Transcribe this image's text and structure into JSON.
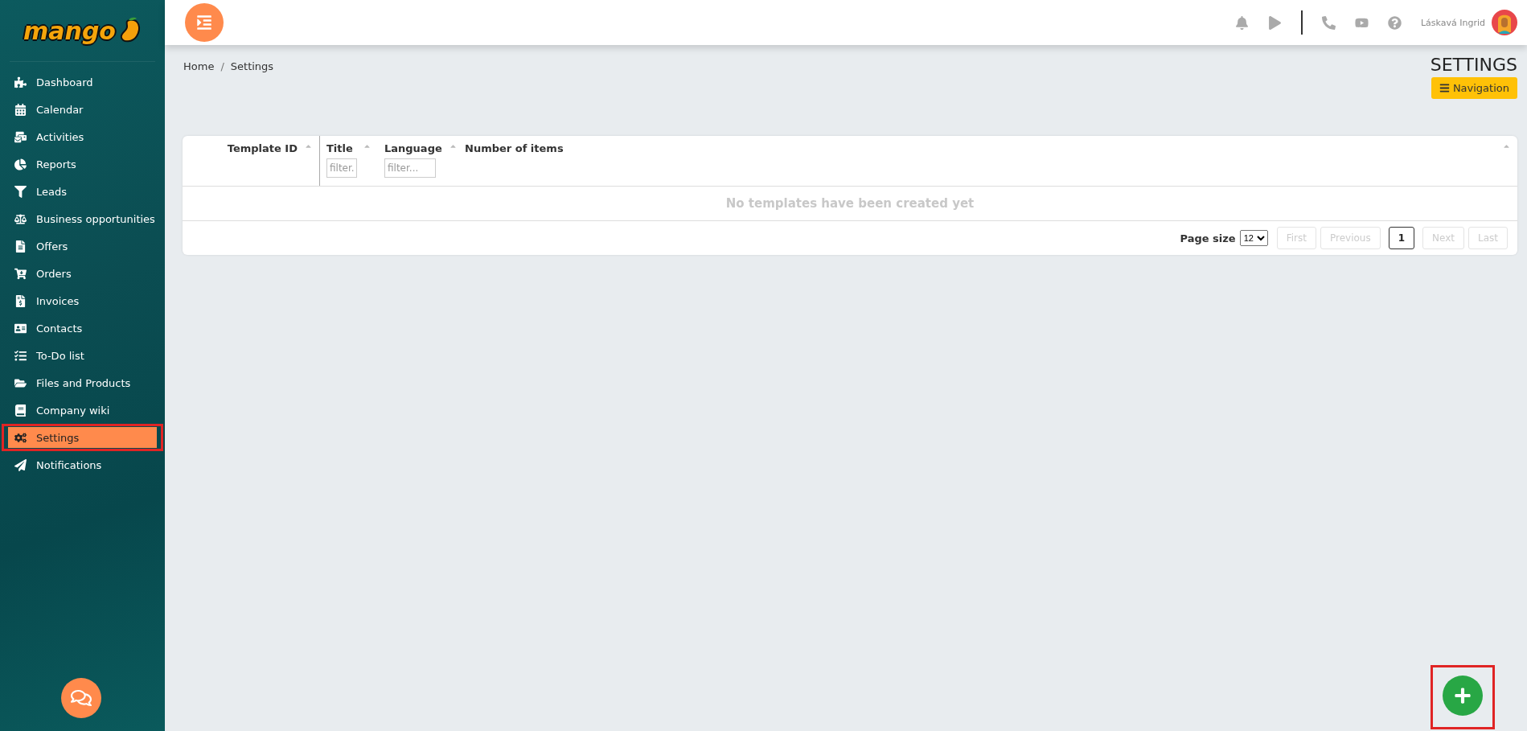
{
  "logo": {
    "text": "mango"
  },
  "sidebar": {
    "items": [
      {
        "label": "Dashboard",
        "selected": false
      },
      {
        "label": "Calendar",
        "selected": false
      },
      {
        "label": "Activities",
        "selected": false
      },
      {
        "label": "Reports",
        "selected": false
      },
      {
        "label": "Leads",
        "selected": false
      },
      {
        "label": "Business opportunities",
        "selected": false
      },
      {
        "label": "Offers",
        "selected": false
      },
      {
        "label": "Orders",
        "selected": false
      },
      {
        "label": "Invoices",
        "selected": false
      },
      {
        "label": "Contacts",
        "selected": false
      },
      {
        "label": "To-Do list",
        "selected": false
      },
      {
        "label": "Files and Products",
        "selected": false
      },
      {
        "label": "Company wiki",
        "selected": false
      },
      {
        "label": "Settings",
        "selected": true
      },
      {
        "label": "Notifications",
        "selected": false
      }
    ]
  },
  "header": {
    "user_name": "Láskavá Ingrid"
  },
  "breadcrumb": {
    "items": [
      "Home",
      "Settings"
    ],
    "separator": "/"
  },
  "page_title": "SETTINGS",
  "navigation_button": "Navigation",
  "table": {
    "columns": [
      {
        "label": "Template ID"
      },
      {
        "label": "Title",
        "placeholder": "filter."
      },
      {
        "label": "Language",
        "placeholder": "filter..."
      },
      {
        "label": "Number of items"
      }
    ],
    "empty_message": "No templates have been created yet",
    "page_size_label": "Page size",
    "page_size": "12",
    "pages": [
      {
        "label": "First",
        "disabled": true,
        "selected": false
      },
      {
        "label": "Previous",
        "disabled": true,
        "selected": false
      },
      {
        "label": "1",
        "disabled": false,
        "selected": true
      },
      {
        "label": "Next",
        "disabled": true,
        "selected": false
      },
      {
        "label": "Last",
        "disabled": true,
        "selected": false
      }
    ]
  }
}
